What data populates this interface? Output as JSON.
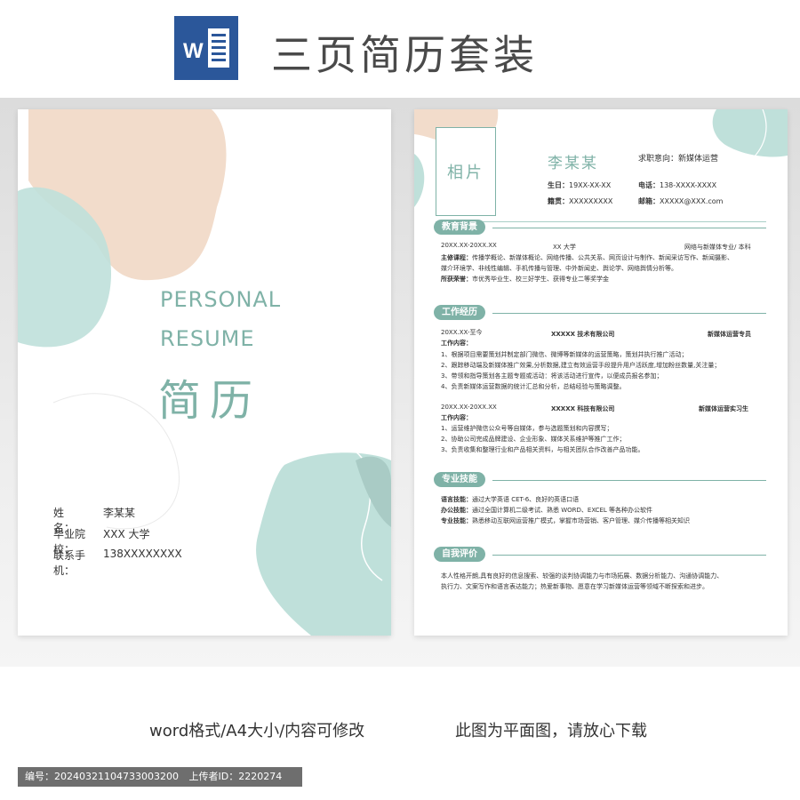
{
  "banner": {
    "title": "三页简历套装",
    "icon": "word-icon",
    "icon_letter": "W"
  },
  "cover": {
    "personal": "PERSONAL",
    "resume": "RESUME",
    "title_cn": "简历",
    "info": [
      {
        "label": "姓　　名：",
        "value": "李某某"
      },
      {
        "label": "毕业院校：",
        "value": "XXX 大学"
      },
      {
        "label": "联系手机：",
        "value": "138XXXXXXXX"
      }
    ]
  },
  "resume": {
    "photo": "相片",
    "name": "李某某",
    "intent": "求职意向：新媒体运营",
    "birth": {
      "label": "生日：",
      "value": "19XX-XX-XX"
    },
    "phone": {
      "label": "电话：",
      "value": "138-XXXX-XXXX"
    },
    "hometown": {
      "label": "籍贯：",
      "value": "XXXXXXXXX"
    },
    "email": {
      "label": "邮箱：",
      "value": "XXXXX@XXX.com"
    },
    "education": {
      "title": "教育背景",
      "period": "20XX.XX-20XX.XX",
      "school": "XX 大学",
      "major": "网络与新媒体专业/ 本科",
      "courses_label": "主修课程：",
      "courses_1": "传播学概论、新媒体概论、网络传播、公共关系、网页设计与制作、新闻采访写作、新闻摄影、",
      "courses_2": "媒介环境学、非线性编辑、手机传播与管理、中外新闻史、舆论学、网络舆情分析等。",
      "honors_label": "所获荣誉：",
      "honors": "市优秀毕业生、校三好学生、获得专业二等奖学金"
    },
    "work": {
      "title": "工作经历",
      "job1": {
        "period": "20XX.XX-至今",
        "company": "XXXXX 技术有限公司",
        "position": "新媒体运营专员",
        "content_label": "工作内容：",
        "items": [
          "1、根据项目需要策划并制定部门微信、微博等新媒体的运营策略，策划并执行推广活动；",
          "2、跟踪移动端及新媒体推广效果,分析数据,建立有效运营手段提升用户活跃度,增加粉丝数量,关注量；",
          "3、带领和指导策划各主题专题或活动：将该活动进行宣传，以便成员报名参加；",
          "4、负责新媒体运营数据的统计汇总和分析，总结经验与策略调整。"
        ]
      },
      "job2": {
        "period": "20XX.XX-20XX.XX",
        "company": "XXXXX 科技有限公司",
        "position": "新媒体运营实习生",
        "content_label": "工作内容：",
        "items": [
          "1、运营维护微信公众号等自媒体，参与选题策划和内容撰写；",
          "2、协助公司完成品牌建设、企业形象、媒体关系维护等推广工作；",
          "3、负责收集和整理行业和产品相关资料，与相关团队合作改善产品功能。"
        ]
      }
    },
    "skills": {
      "title": "专业技能",
      "lang_label": "语言技能：",
      "lang": "通过大学英语 CET-6、良好的英语口语",
      "office_label": "办公技能：",
      "office": "通过全国计算机二级考试、熟悉 WORD、EXCEL 等各种办公软件",
      "pro_label": "专业技能：",
      "pro": "熟悉移动互联网运营推广模式，掌握市场营销、客户管理、媒介传播等相关知识"
    },
    "self": {
      "title": "自我评价",
      "line1": "本人性格开朗,具有良好的信息搜索、较强的谈判协调能力与市场拓展、数据分析能力、沟通协调能力、",
      "line2": "执行力、文案写作和语言表达能力；热爱新事物、愿意在学习新媒体运营等领域不断探索和进步。"
    }
  },
  "footer": {
    "left": "word格式/A4大小/内容可修改",
    "right": "此图为平面图，请放心下载",
    "id_label": "编号：",
    "id_value": "20240321104733003200",
    "uploader_label": "上传者ID：",
    "uploader_value": "2220274"
  },
  "colors": {
    "accent": "#7fb2a7",
    "peach": "#f2dccb",
    "mint": "#bfe0da",
    "word_blue": "#2b579a"
  }
}
